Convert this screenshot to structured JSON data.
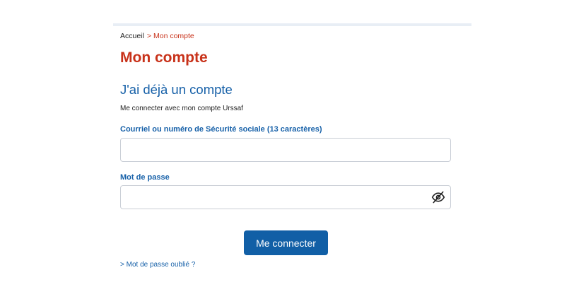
{
  "breadcrumb": {
    "home": "Accueil",
    "separator": ">",
    "current": "Mon compte"
  },
  "page": {
    "title": "Mon compte"
  },
  "login": {
    "section_title": "J'ai déjà un compte",
    "intro": "Me connecter avec mon compte Urssaf",
    "email_label": "Courriel ou numéro de Sécurité sociale (13 caractères)",
    "email_value": "",
    "password_label": "Mot de passe",
    "password_value": "",
    "password_toggle_icon": "eye-slash-icon",
    "submit_label": "Me connecter",
    "forgot_link": "> Mot de passe oublié ?"
  },
  "colors": {
    "title_red": "#c8321a",
    "link_blue": "#1660a8",
    "button_blue": "#115fa6",
    "border_gray": "#c9ced6"
  }
}
